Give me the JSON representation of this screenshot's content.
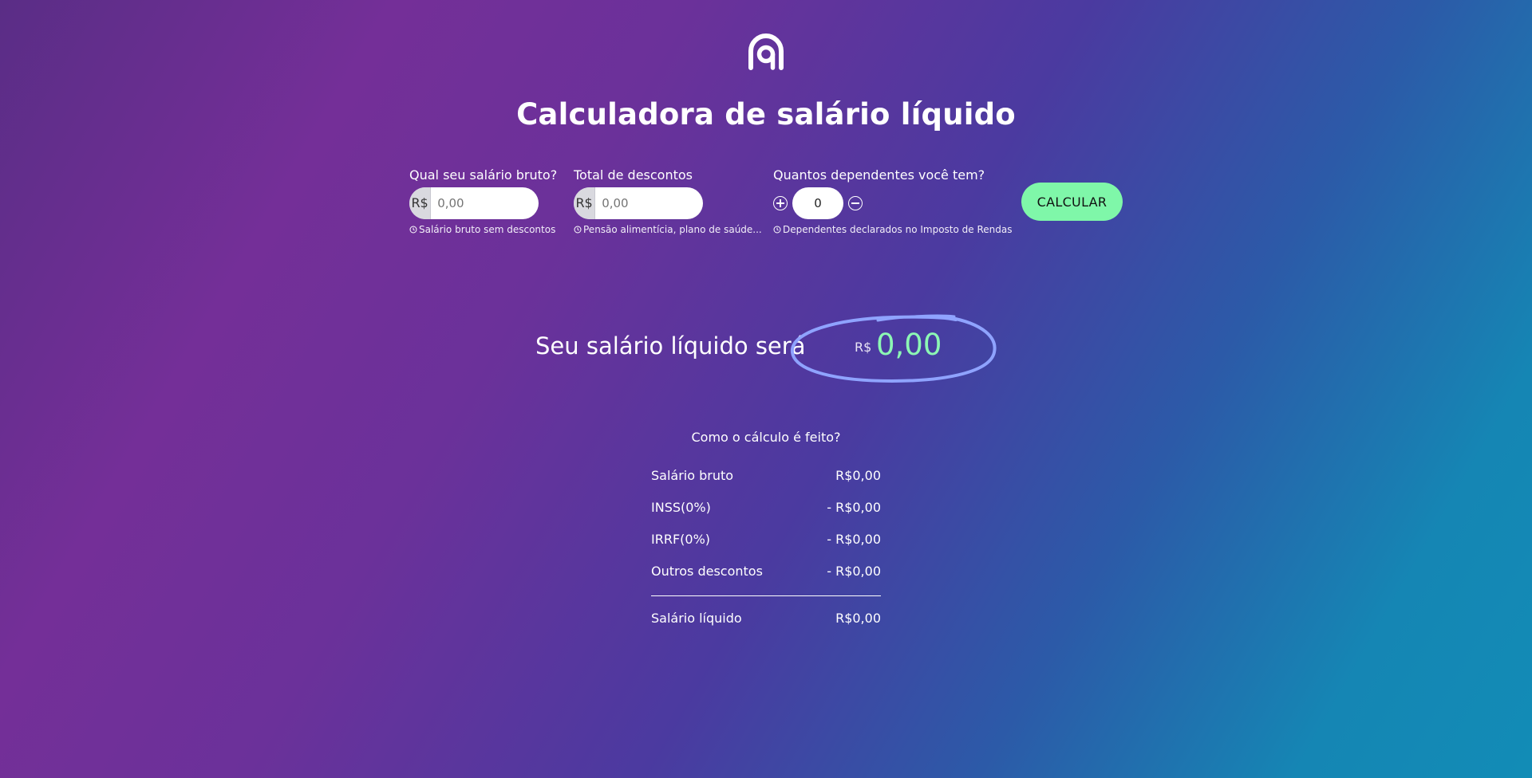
{
  "header": {
    "logo_icon": "ame-logo-icon",
    "title": "Calculadora de salário líquido"
  },
  "form": {
    "gross": {
      "label": "Qual seu salário bruto?",
      "prefix": "R$",
      "value": "",
      "placeholder": "0,00",
      "hint": "Salário bruto sem descontos"
    },
    "discounts": {
      "label": "Total de descontos",
      "prefix": "R$",
      "value": "",
      "placeholder": "0,00",
      "hint": "Pensão alimentícia, plano de saúde..."
    },
    "dependents": {
      "label": "Quantos dependentes você tem?",
      "value": "0",
      "hint": "Dependentes declarados no Imposto de Rendas",
      "increment_icon": "plus-circle-icon",
      "decrement_icon": "minus-circle-icon"
    },
    "calculate_label": "CALCULAR",
    "calculate_color": "#7ff7a9"
  },
  "result": {
    "label": "Seu salário líquido será",
    "currency": "R$",
    "value": "0,00",
    "value_color": "#8cf7b4",
    "circle_color": "#8fa3ff"
  },
  "breakdown": {
    "title": "Como o cálculo é feito?",
    "rows": [
      {
        "label": "Salário bruto",
        "value": "R$0,00"
      },
      {
        "label": "INSS(0%)",
        "value": "- R$0,00"
      },
      {
        "label": "IRRF(0%)",
        "value": "- R$0,00"
      },
      {
        "label": "Outros descontos",
        "value": "- R$0,00"
      }
    ],
    "total": {
      "label": "Salário líquido",
      "value": "R$0,00"
    }
  }
}
